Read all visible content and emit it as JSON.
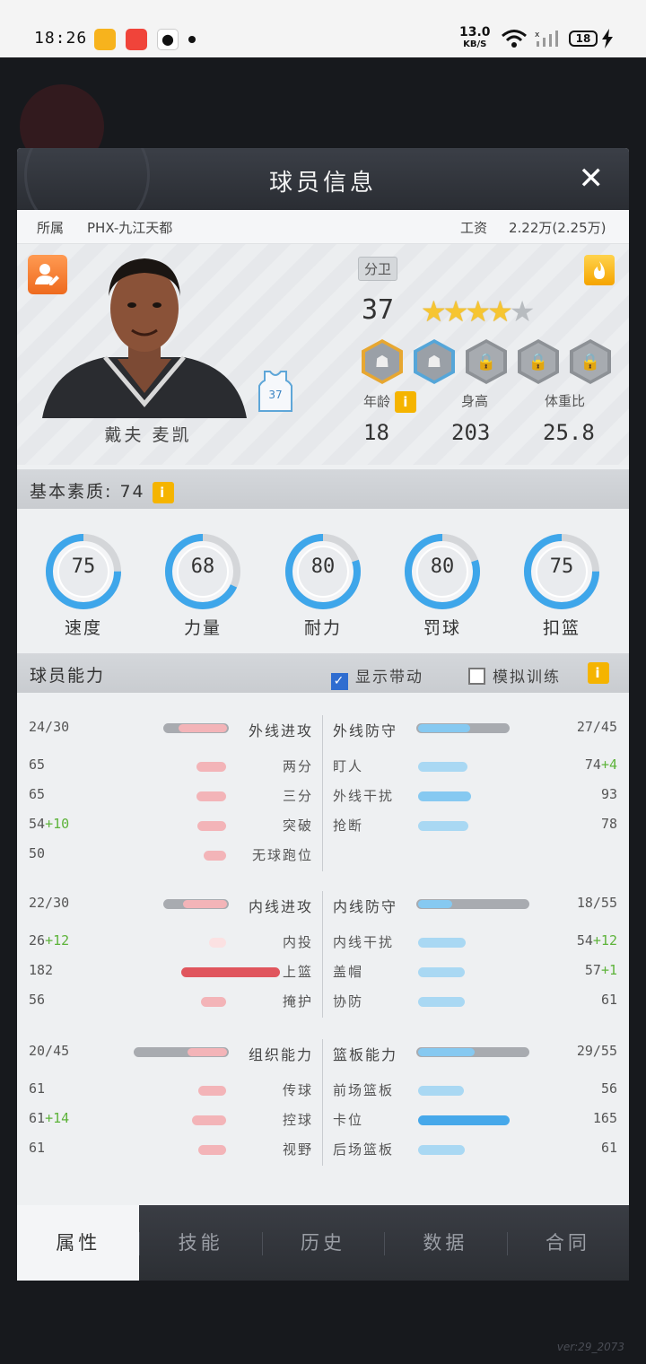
{
  "status_bar": {
    "time": "18:26",
    "net_speed": "13.0",
    "net_unit": "KB/S",
    "battery": "18"
  },
  "dialog": {
    "title": "球员信息",
    "close_glyph": "✕",
    "team_label": "所属",
    "team_name": "PHX-九江天都",
    "salary_label": "工资",
    "salary_value": "2.22万(2.25万)",
    "player": {
      "name": "戴夫 麦凯",
      "position": "分卫",
      "jersey_number": "37",
      "overall": "37",
      "stars": 4,
      "stars_max": 5,
      "badge_glyphs": [
        "☗",
        "☗",
        "🔒",
        "🔒",
        "🔒"
      ],
      "age_label": "年龄",
      "height_label": "身高",
      "weight_ratio_label": "体重比",
      "age": "18",
      "height": "203",
      "weight_ratio": "25.8",
      "info_glyph": "i"
    },
    "basic": {
      "title": "基本素质: 74",
      "rings": [
        {
          "label": "速度",
          "value": "75",
          "pct": 75
        },
        {
          "label": "力量",
          "value": "68",
          "pct": 68
        },
        {
          "label": "耐力",
          "value": "80",
          "pct": 80
        },
        {
          "label": "罚球",
          "value": "80",
          "pct": 80
        },
        {
          "label": "扣篮",
          "value": "75",
          "pct": 75
        }
      ]
    },
    "ability": {
      "title": "球员能力",
      "show_bonus_label": "显示带动",
      "show_bonus_checked": true,
      "sim_training_label": "模拟训练",
      "sim_training_checked": false,
      "groups": [
        {
          "left_title": "外线进攻",
          "left_score": "24/30",
          "left_fill": 0.8,
          "right_title": "外线防守",
          "right_score": "27/45",
          "right_fill": 0.6,
          "rows": [
            {
              "lv": "65",
              "lplus": "",
              "lname": "两分",
              "lfill": 0.65,
              "rname": "盯人",
              "rv": "74",
              "rplus": "+4",
              "rfill": 0.74
            },
            {
              "lv": "65",
              "lplus": "",
              "lname": "三分",
              "lfill": 0.65,
              "rname": "外线干扰",
              "rv": "93",
              "rplus": "",
              "rfill": 0.93
            },
            {
              "lv": "54",
              "lplus": "+10",
              "lname": "突破",
              "lfill": 0.64,
              "rname": "抢断",
              "rv": "78",
              "rplus": "",
              "rfill": 0.78
            },
            {
              "lv": "50",
              "lplus": "",
              "lname": "无球跑位",
              "lfill": 0.5,
              "rname": "",
              "rv": "",
              "rplus": "",
              "rfill": 0
            }
          ]
        },
        {
          "left_title": "内线进攻",
          "left_score": "22/30",
          "left_fill": 0.73,
          "right_title": "内线防守",
          "right_score": "18/55",
          "right_fill": 0.33,
          "rows": [
            {
              "lv": "26",
              "lplus": "+12",
              "lname": "内投",
              "lfill": 0.38,
              "rname": "内线干扰",
              "rv": "54",
              "rplus": "+12",
              "rfill": 0.66
            },
            {
              "lv": "182",
              "lplus": "",
              "lname": "上篮",
              "lfill": 1.0,
              "rname": "盖帽",
              "rv": "57",
              "rplus": "+1",
              "rfill": 0.58
            },
            {
              "lv": "56",
              "lplus": "",
              "lname": "掩护",
              "lfill": 0.56,
              "rname": "协防",
              "rv": "61",
              "rplus": "",
              "rfill": 0.61
            }
          ]
        },
        {
          "left_title": "组织能力",
          "left_score": "20/45",
          "left_fill": 0.45,
          "right_title": "篮板能力",
          "right_score": "29/55",
          "right_fill": 0.53,
          "rows": [
            {
              "lv": "61",
              "lplus": "",
              "lname": "传球",
              "lfill": 0.61,
              "rname": "前场篮板",
              "rv": "56",
              "rplus": "",
              "rfill": 0.56
            },
            {
              "lv": "61",
              "lplus": "+14",
              "lname": "控球",
              "lfill": 0.75,
              "rname": "卡位",
              "rv": "165",
              "rplus": "",
              "rfill": 1.0
            },
            {
              "lv": "61",
              "lplus": "",
              "lname": "视野",
              "lfill": 0.61,
              "rname": "后场篮板",
              "rv": "61",
              "rplus": "",
              "rfill": 0.61
            }
          ]
        }
      ]
    },
    "tabs": [
      "属性",
      "技能",
      "历史",
      "数据",
      "合同"
    ],
    "active_tab": 0
  },
  "version": "ver:29_2073",
  "colors": {
    "accent_orange": "#ee6a1e",
    "info_yellow": "#f5b400",
    "ring_blue": "#3ea6ea",
    "attack_red": "#e0555d",
    "defense_blue": "#46a8ea",
    "bonus_green": "#5db33a"
  }
}
